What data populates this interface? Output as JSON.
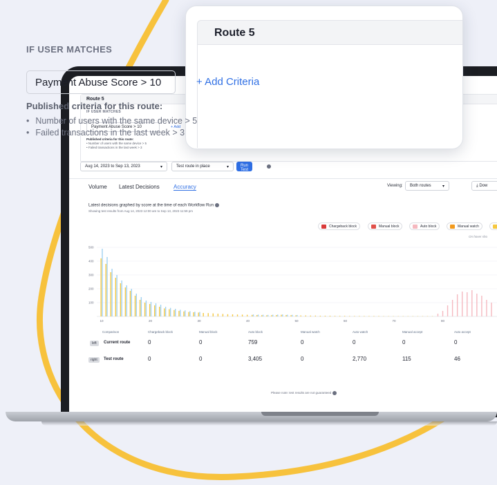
{
  "route": {
    "title": "Route 5",
    "section_label": "IF USER MATCHES",
    "criteria_value": "Payment Abuse Score > 10",
    "add_criteria": "+ Add Criteria",
    "add_criteria_short": "+ Add",
    "published_title": "Published criteria for this route:",
    "published_items": [
      "Number of users with the same device > 5",
      "Failed transactions in the last week > 3"
    ]
  },
  "controls": {
    "date_range": "Aug 14, 2023 to Sep 13, 2023",
    "mode": "Test route in place",
    "run_button": "Run Test"
  },
  "tabs": [
    {
      "label": "Volume"
    },
    {
      "label": "Latest Decisions"
    },
    {
      "label": "Accuracy"
    }
  ],
  "viewing": {
    "label": "Viewing:",
    "value": "Both routes"
  },
  "download_label": "Dow",
  "chart_header": {
    "title": "Latest decisions graphed by score at the time of each Workflow Run",
    "subtitle": "Showing test results from Aug 14, 2023 12:00 am to Sep 13, 2023 11:59 pm",
    "hover_note": "On hover sho"
  },
  "legend": [
    {
      "label": "Chargeback block",
      "color": "#d93a3a"
    },
    {
      "label": "Manual block",
      "color": "#e0504a"
    },
    {
      "label": "Auto block",
      "color": "#f5b8bf"
    },
    {
      "label": "Manual watch",
      "color": "#f29a1d"
    },
    {
      "label": "",
      "color": "#f5c842"
    }
  ],
  "chart_data": {
    "type": "bar",
    "x_ticks": [
      10,
      20,
      30,
      40,
      50,
      60,
      70,
      80
    ],
    "y_ticks": [
      100,
      200,
      300,
      400,
      500
    ],
    "ylim": [
      0,
      500
    ],
    "xlim": [
      9,
      90
    ],
    "series": [
      {
        "name": "Auto accept",
        "color": "#f5c842",
        "x": [
          10,
          11,
          12,
          13,
          14,
          15,
          16,
          17,
          18,
          19,
          20,
          21,
          22,
          23,
          24,
          25,
          26,
          27,
          28,
          29,
          30,
          31,
          32,
          33,
          34,
          35,
          36,
          37,
          38,
          39,
          40,
          41,
          42,
          43,
          44,
          45,
          46,
          47,
          48,
          49,
          50,
          51,
          52,
          53,
          54,
          55,
          56,
          57,
          58,
          59,
          60,
          61,
          62,
          63,
          64,
          65,
          66,
          67,
          68,
          69,
          70,
          71,
          72,
          73,
          74,
          75,
          76,
          77,
          78
        ],
        "values": [
          420,
          380,
          320,
          280,
          240,
          210,
          185,
          150,
          120,
          100,
          90,
          80,
          70,
          58,
          52,
          46,
          40,
          36,
          32,
          30,
          28,
          25,
          24,
          22,
          20,
          18,
          16,
          15,
          14,
          13,
          12,
          11,
          10,
          9,
          8,
          9,
          10,
          12,
          10,
          9,
          8,
          7,
          7,
          6,
          6,
          5,
          5,
          5,
          4,
          4,
          4,
          3,
          3,
          3,
          3,
          3,
          3,
          3,
          2,
          2,
          2,
          2,
          2,
          2,
          2,
          2,
          2,
          2,
          2
        ]
      },
      {
        "name": "Auto watch",
        "color": "#9fd1f0",
        "x": [
          10,
          11,
          12,
          13,
          14,
          15,
          16,
          17,
          18,
          19,
          20,
          21,
          22,
          23,
          24,
          25,
          26,
          27,
          28,
          29,
          30,
          41,
          42,
          43,
          44,
          45,
          46,
          47,
          48,
          49,
          50
        ],
        "values": [
          490,
          430,
          345,
          300,
          260,
          225,
          200,
          165,
          140,
          115,
          105,
          95,
          85,
          70,
          62,
          55,
          48,
          44,
          38,
          34,
          32,
          14,
          13,
          12,
          11,
          12,
          13,
          14,
          12,
          11,
          10
        ]
      },
      {
        "name": "Auto block",
        "color": "#f5b8bf",
        "x": [
          79,
          80,
          81,
          82,
          83,
          84,
          85,
          86,
          87,
          88,
          89,
          90
        ],
        "values": [
          20,
          40,
          80,
          120,
          160,
          180,
          175,
          190,
          165,
          150,
          120,
          100
        ]
      }
    ]
  },
  "table": {
    "columns": [
      "Comparison",
      "Chargeback block",
      "Manual block",
      "Auto block",
      "Manual watch",
      "Auto watch",
      "Manual accept",
      "Auto accept"
    ],
    "rows": [
      {
        "tag": "left",
        "label": "Current route",
        "values": [
          "0",
          "0",
          "759",
          "0",
          "0",
          "0",
          "0"
        ]
      },
      {
        "tag": "right",
        "label": "Test route",
        "values": [
          "0",
          "0",
          "3,405",
          "0",
          "2,770",
          "115",
          "46"
        ]
      }
    ],
    "note": "Please note: test results are not guaranteed"
  }
}
